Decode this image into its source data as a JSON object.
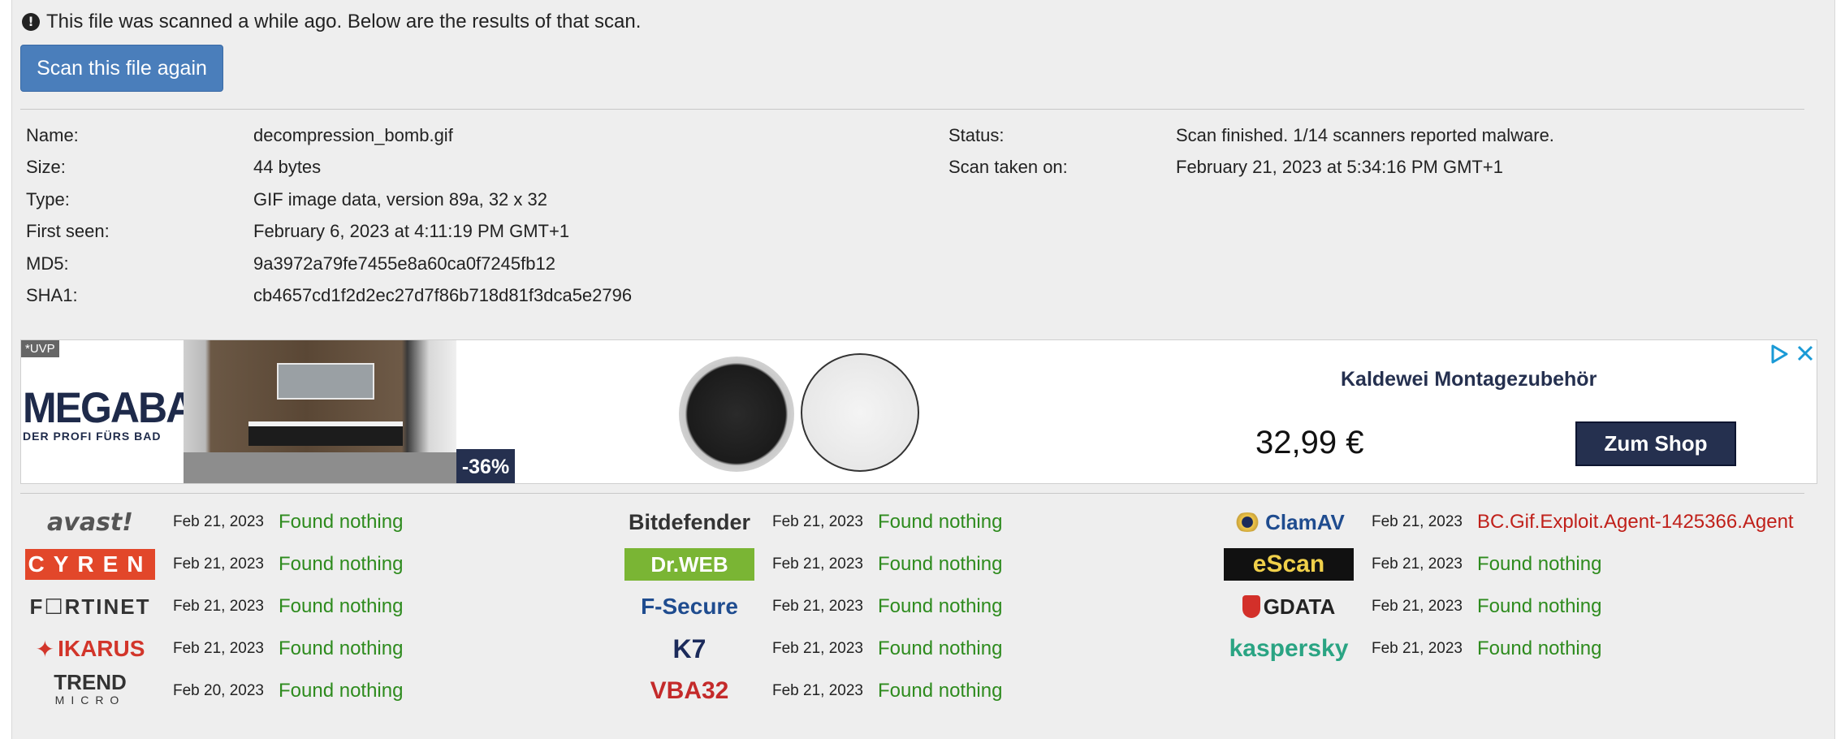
{
  "notice": {
    "icon": "exclamation-circle-icon",
    "text": "This file was scanned a while ago. Below are the results of that scan."
  },
  "rescan_label": "Scan this file again",
  "file_info": {
    "left": [
      {
        "label": "Name:",
        "value": "decompression_bomb.gif"
      },
      {
        "label": "Size:",
        "value": "44 bytes"
      },
      {
        "label": "Type:",
        "value": "GIF image data, version 89a, 32 x 32"
      },
      {
        "label": "First seen:",
        "value": "February 6, 2023 at 4:11:19 PM GMT+1"
      },
      {
        "label": "MD5:",
        "value": "9a3972a79fe7455e8a60ca0f7245fb12"
      },
      {
        "label": "SHA1:",
        "value": "cb4657cd1f2d2ec27d7f86b718d81f3dca5e2796"
      }
    ],
    "right": [
      {
        "label": "Status:",
        "value": "Scan finished. 1/14 scanners reported malware."
      },
      {
        "label": "Scan taken on:",
        "value": "February 21, 2023 at 5:34:16 PM GMT+1"
      }
    ]
  },
  "ad": {
    "uvp": "*UVP",
    "brand": "MEGABAD",
    "brand_tagline": "DER PROFI FÜRS BAD",
    "discount": "-36%",
    "title": "Kaldewei Montagezubehör",
    "price": "32,99 €",
    "shop_label": "Zum Shop",
    "accent": "#25304f"
  },
  "colors": {
    "ok": "#2e8b1e",
    "malware": "#c0201a",
    "button": "#4a7ebb"
  },
  "scanners": [
    {
      "name": "avast",
      "logo": "avast!",
      "date": "Feb 21, 2023",
      "result": "Found nothing",
      "malware": false
    },
    {
      "name": "cyren",
      "logo": "CYREN",
      "date": "Feb 21, 2023",
      "result": "Found nothing",
      "malware": false
    },
    {
      "name": "fortinet",
      "logo": "F☐RTINET",
      "date": "Feb 21, 2023",
      "result": "Found nothing",
      "malware": false
    },
    {
      "name": "ikarus",
      "logo": "IKARUS",
      "date": "Feb 21, 2023",
      "result": "Found nothing",
      "malware": false
    },
    {
      "name": "trend-micro",
      "logo": "TREND",
      "logo_sub": "MICRO",
      "date": "Feb 20, 2023",
      "result": "Found nothing",
      "malware": false
    },
    {
      "name": "bitdefender",
      "logo": "Bitdefender",
      "date": "Feb 21, 2023",
      "result": "Found nothing",
      "malware": false
    },
    {
      "name": "drweb",
      "logo": "Dr.WEB",
      "date": "Feb 21, 2023",
      "result": "Found nothing",
      "malware": false
    },
    {
      "name": "f-secure",
      "logo": "F-Secure",
      "date": "Feb 21, 2023",
      "result": "Found nothing",
      "malware": false
    },
    {
      "name": "k7",
      "logo": "K7",
      "date": "Feb 21, 2023",
      "result": "Found nothing",
      "malware": false
    },
    {
      "name": "vba32",
      "logo": "VBA32",
      "date": "Feb 21, 2023",
      "result": "Found nothing",
      "malware": false
    },
    {
      "name": "clamav",
      "logo": "ClamAV",
      "date": "Feb 21, 2023",
      "result": "BC.Gif.Exploit.Agent-1425366.Agent",
      "malware": true
    },
    {
      "name": "escan",
      "logo": "eScan",
      "date": "Feb 21, 2023",
      "result": "Found nothing",
      "malware": false
    },
    {
      "name": "gdata",
      "logo": "GDATA",
      "date": "Feb 21, 2023",
      "result": "Found nothing",
      "malware": false
    },
    {
      "name": "kaspersky",
      "logo": "kaspersky",
      "date": "Feb 21, 2023",
      "result": "Found nothing",
      "malware": false
    }
  ]
}
